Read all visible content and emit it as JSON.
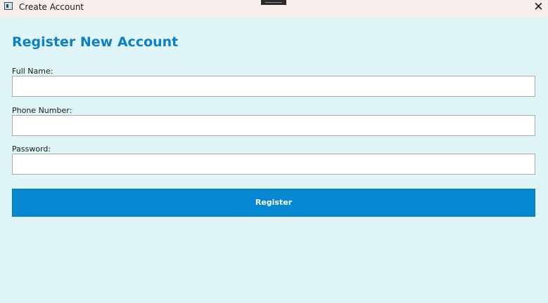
{
  "window": {
    "title": "Create Account",
    "close_glyph": "✕",
    "icons": {
      "app": "app-window-icon",
      "close": "close-icon"
    }
  },
  "form": {
    "heading": "Register New Account",
    "fields": [
      {
        "label": "Full Name:",
        "value": "",
        "type": "text"
      },
      {
        "label": "Phone Number:",
        "value": "",
        "type": "text"
      },
      {
        "label": "Password:",
        "value": "",
        "type": "password"
      }
    ],
    "submit_label": "Register"
  },
  "colors": {
    "background": "#dff5f8",
    "titlebar": "#f8efed",
    "heading": "#0b7fc7",
    "button": "#0588d1",
    "button_text": "#ffffff"
  }
}
